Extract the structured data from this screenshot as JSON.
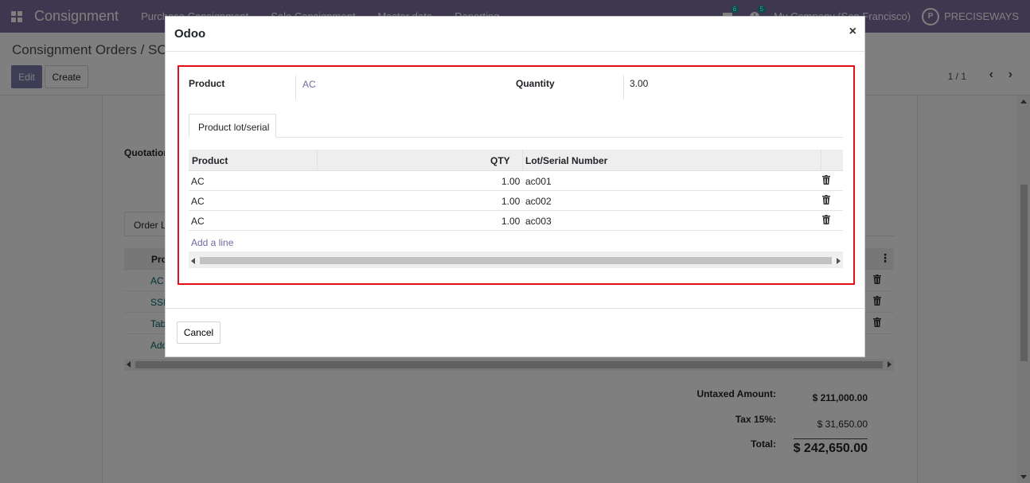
{
  "navbar": {
    "brand": "Consignment",
    "menu": [
      "Purchase Consignment",
      "Sale Consignment",
      "Master data",
      "Reporting"
    ],
    "chat_count": "6",
    "activity_count": "5",
    "company": "My Company (San Francisco)",
    "logo_text": "PRECISEWAYS"
  },
  "control_panel": {
    "breadcrumb": "Consignment Orders / SCO",
    "edit_label": "Edit",
    "create_label": "Create",
    "pager": "1 / 1"
  },
  "background_form": {
    "quotation_label": "Quotation",
    "tab_label": "Order L",
    "column_label": "Pro",
    "rows": [
      "AC",
      "SSI",
      "Tab"
    ],
    "add_label": "Add",
    "totals": {
      "untaxed_label": "Untaxed Amount:",
      "untaxed_value": "$ 211,000.00",
      "tax_label": "Tax 15%:",
      "tax_value": "$ 31,650.00",
      "total_label": "Total:",
      "total_value": "$ 242,650.00"
    }
  },
  "modal": {
    "title": "Odoo",
    "close_glyph": "×",
    "product_label": "Product",
    "product_value": "AC",
    "quantity_label": "Quantity",
    "quantity_value": "3.00",
    "tab_label": "Product lot/serial",
    "table": {
      "headers": [
        "Product",
        "QTY",
        "Lot/Serial Number"
      ],
      "rows": [
        {
          "product": "AC",
          "qty": "1.00",
          "lot": "ac001"
        },
        {
          "product": "AC",
          "qty": "1.00",
          "lot": "ac002"
        },
        {
          "product": "AC",
          "qty": "1.00",
          "lot": "ac003"
        }
      ]
    },
    "add_line_label": "Add a line",
    "cancel_label": "Cancel"
  },
  "colors": {
    "navbar": "#7c6f9f",
    "primary": "#7c7bad",
    "highlight": "#e0101d",
    "link": "#6f6aa3"
  }
}
